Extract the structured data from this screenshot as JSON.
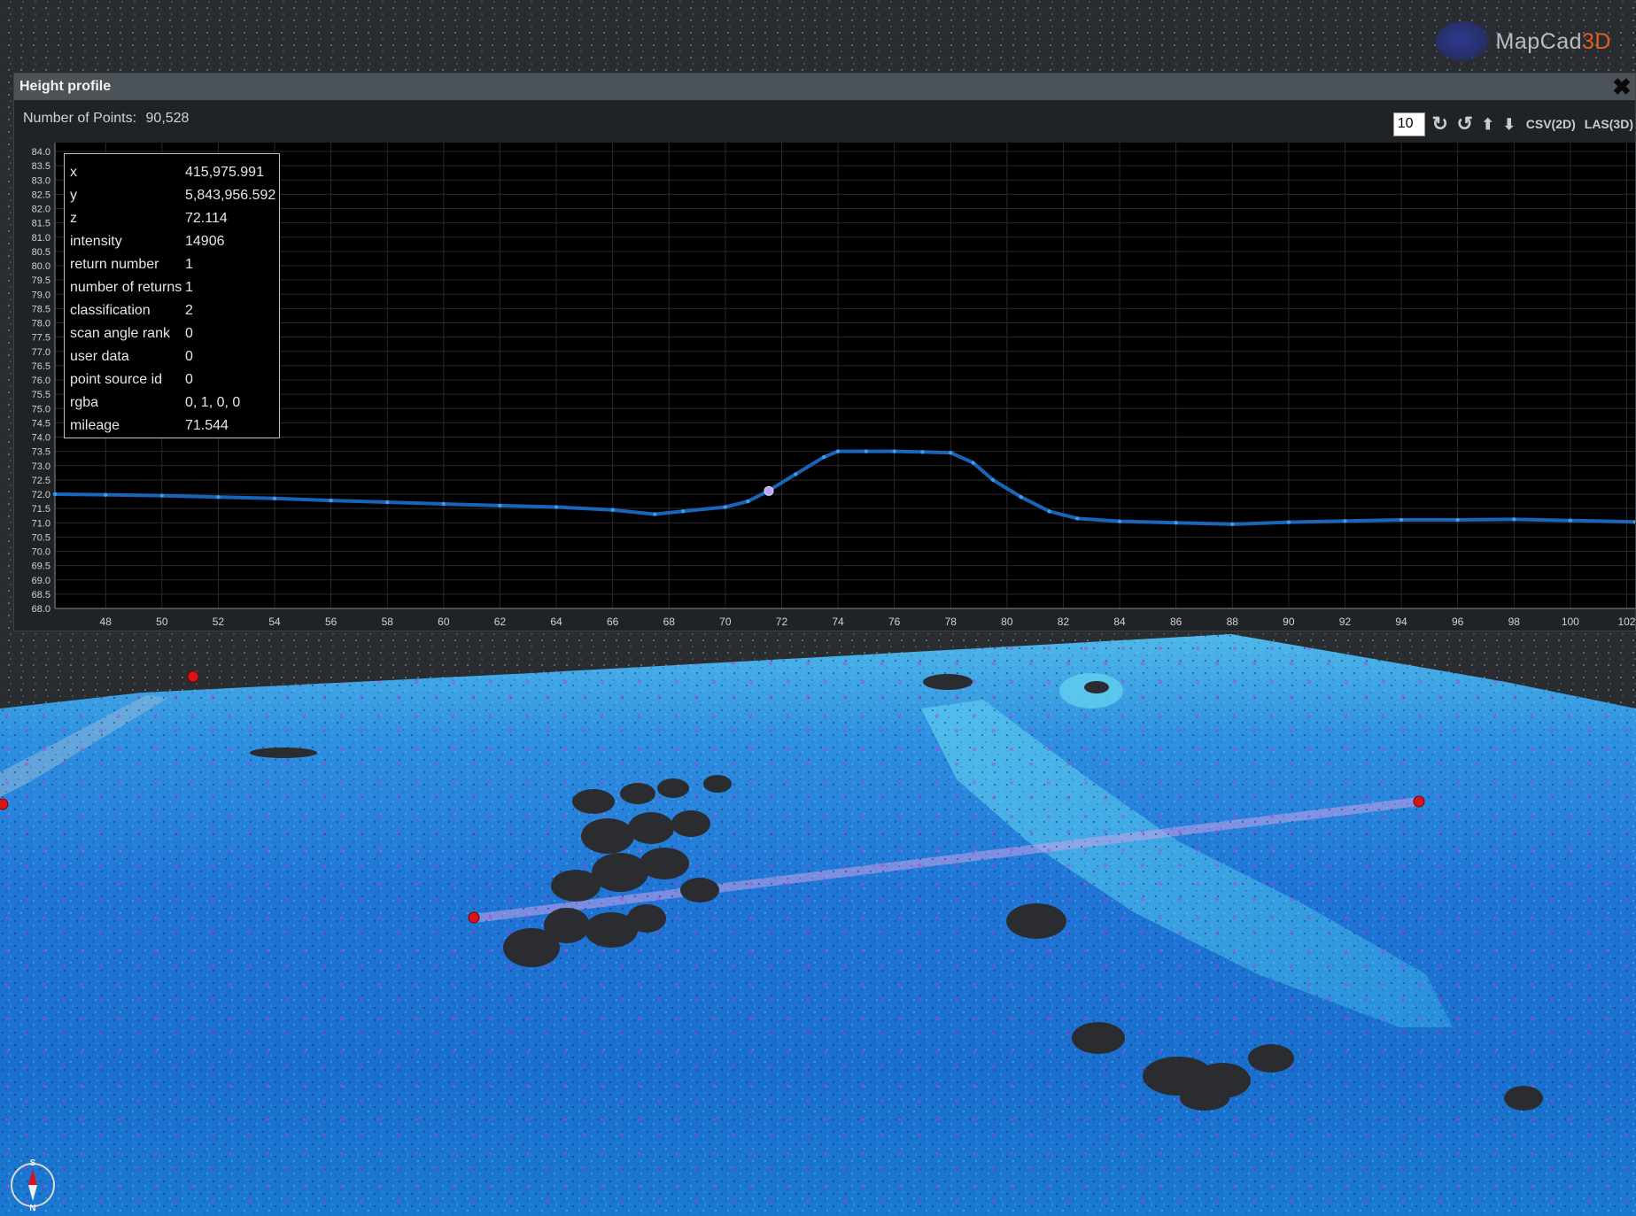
{
  "app": {
    "logo_main": "MapCad",
    "logo_accent": "3D"
  },
  "panel": {
    "title": "Height profile",
    "close_icon": "close-icon",
    "points_label": "Number of Points:",
    "points_value": "90,528",
    "toolbar": {
      "step_value": "10",
      "rotate_cw_icon": "rotate-cw-icon",
      "rotate_ccw_icon": "rotate-ccw-icon",
      "arrow_up_icon": "arrow-up-icon",
      "arrow_down_icon": "arrow-down-icon",
      "csv_label": "CSV(2D)",
      "las_label": "LAS(3D)"
    }
  },
  "info": [
    {
      "key": "x",
      "value": "415,975.991"
    },
    {
      "key": "y",
      "value": "5,843,956.592"
    },
    {
      "key": "z",
      "value": "72.114"
    },
    {
      "key": "intensity",
      "value": "14906"
    },
    {
      "key": "return number",
      "value": "1"
    },
    {
      "key": "number of returns",
      "value": "1"
    },
    {
      "key": "classification",
      "value": "2"
    },
    {
      "key": "scan angle rank",
      "value": "0"
    },
    {
      "key": "user data",
      "value": "0"
    },
    {
      "key": "point source id",
      "value": "0"
    },
    {
      "key": "rgba",
      "value": "0, 1, 0, 0"
    },
    {
      "key": "mileage",
      "value": "71.544"
    }
  ],
  "chart_data": {
    "type": "scatter",
    "title": "",
    "xlabel": "",
    "ylabel": "",
    "xlim": [
      46.2,
      102.3
    ],
    "ylim": [
      68.0,
      84.0
    ],
    "x_ticks": [
      "48",
      "50",
      "52",
      "54",
      "56",
      "58",
      "60",
      "62",
      "64",
      "66",
      "68",
      "70",
      "72",
      "74",
      "76",
      "78",
      "80",
      "82",
      "84",
      "86",
      "88",
      "90",
      "92",
      "94",
      "96",
      "98",
      "100",
      "102"
    ],
    "y_ticks": [
      "84.0",
      "83.5",
      "83.0",
      "82.5",
      "82.0",
      "81.5",
      "81.0",
      "80.5",
      "80.0",
      "79.5",
      "79.0",
      "78.5",
      "78.0",
      "77.5",
      "77.0",
      "76.5",
      "76.0",
      "75.5",
      "75.0",
      "74.5",
      "74.0",
      "73.5",
      "73.0",
      "72.5",
      "72.0",
      "71.5",
      "71.0",
      "70.5",
      "70.0",
      "69.5",
      "69.0",
      "68.5",
      "68.0"
    ],
    "grid": true,
    "point_color": "#1d74d8",
    "series": [
      {
        "x": [
          46.2,
          48,
          50,
          52,
          54,
          56,
          58,
          60,
          62,
          64,
          66,
          67.5,
          68.5,
          70,
          70.8,
          71.5,
          72.5,
          73.5,
          74,
          75,
          76,
          77,
          78,
          78.8,
          79.5,
          80.5,
          81.5,
          82.5,
          84,
          86,
          88,
          90,
          92,
          94,
          96,
          98,
          100,
          102.3
        ],
        "y": [
          72.0,
          71.98,
          71.95,
          71.9,
          71.85,
          71.78,
          71.72,
          71.66,
          71.6,
          71.55,
          71.45,
          71.3,
          71.4,
          71.55,
          71.75,
          72.1,
          72.7,
          73.3,
          73.5,
          73.5,
          73.5,
          73.48,
          73.45,
          73.1,
          72.5,
          71.9,
          71.4,
          71.15,
          71.05,
          71.0,
          70.95,
          71.02,
          71.06,
          71.1,
          71.1,
          71.12,
          71.08,
          71.03
        ]
      }
    ],
    "highlight_point": {
      "x": 71.544,
      "y": 72.114
    }
  },
  "scene": {
    "markers": [
      "marker-1",
      "marker-2",
      "marker-3",
      "marker-4"
    ],
    "compass_labels": [
      "S",
      "N"
    ]
  }
}
